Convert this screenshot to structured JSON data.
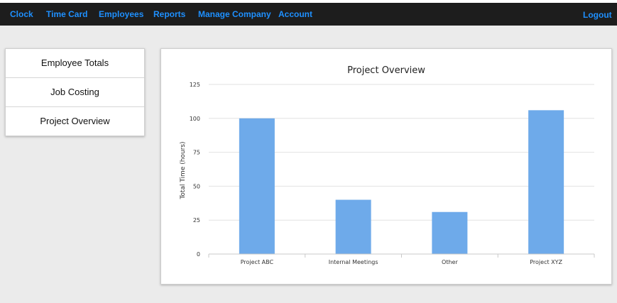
{
  "navbar": {
    "links": [
      "Clock",
      "Time Card",
      "Employees",
      "Reports",
      "Manage Company",
      "Account"
    ],
    "logout": "Logout"
  },
  "sidebar": {
    "items": [
      "Employee Totals",
      "Job Costing",
      "Project Overview"
    ]
  },
  "colors": {
    "navbar_bg": "#1d1d1d",
    "nav_link": "#1e90ff",
    "bar": "#6eaaea"
  },
  "chart_data": {
    "type": "bar",
    "title": "Project Overview",
    "xlabel": "",
    "ylabel": "Total Time (hours)",
    "categories": [
      "Project ABC",
      "Internal Meetings",
      "Other",
      "Project XYZ"
    ],
    "values": [
      100,
      40,
      31,
      106
    ],
    "ylim": [
      0,
      125
    ],
    "yticks": [
      0,
      25,
      50,
      75,
      100,
      125
    ],
    "grid": true
  }
}
